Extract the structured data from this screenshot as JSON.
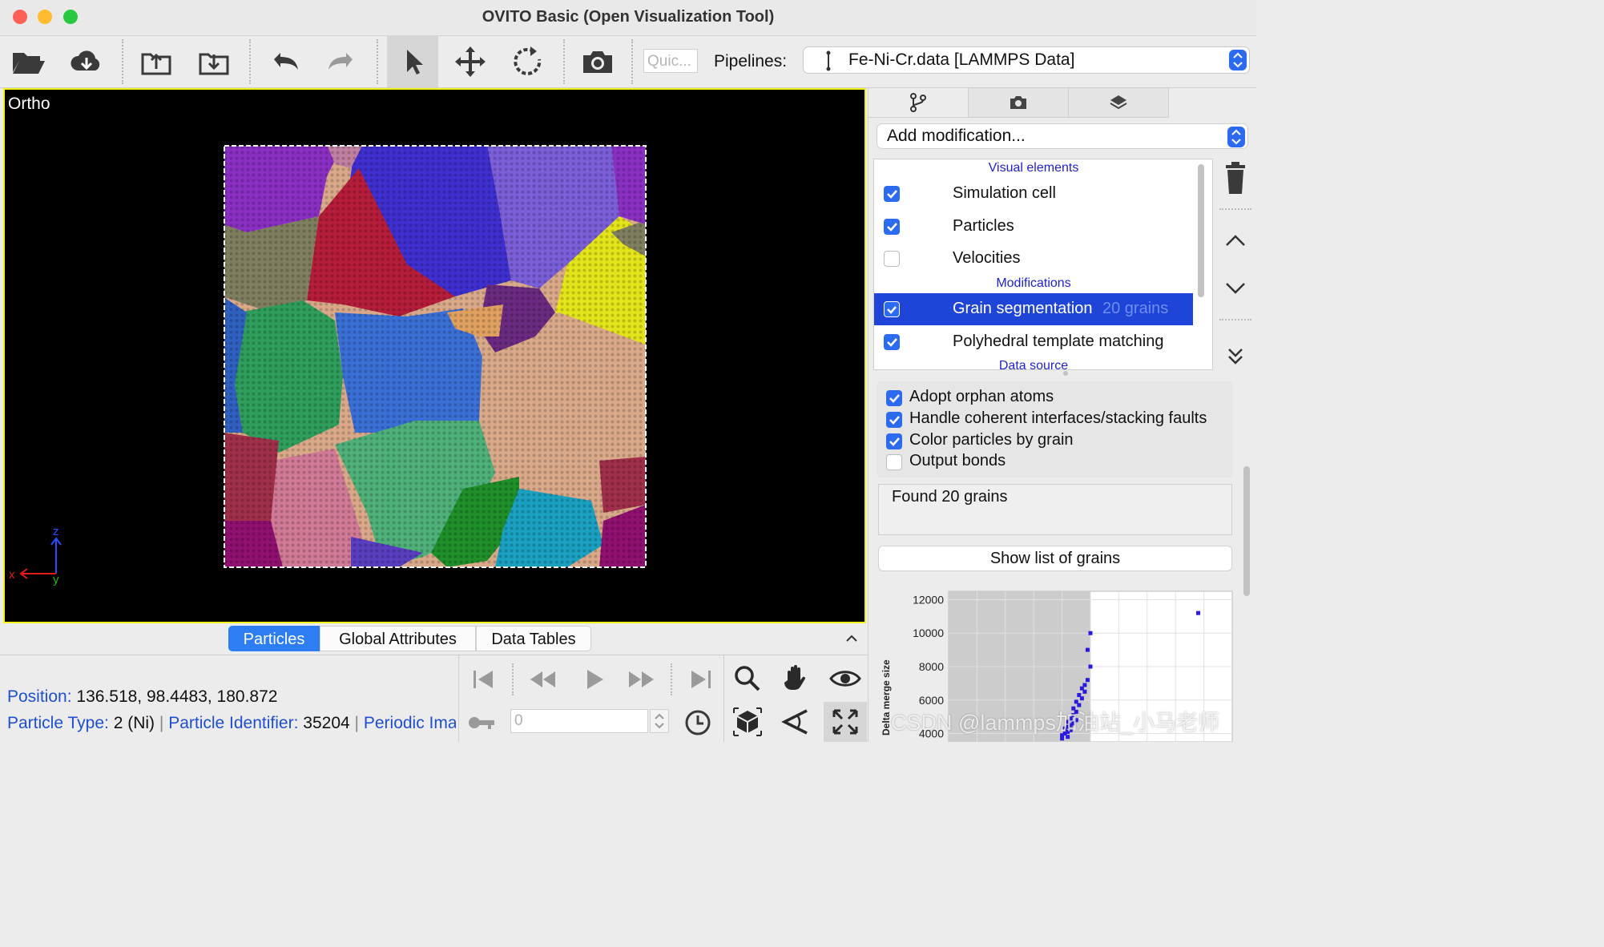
{
  "window": {
    "title": "OVITO Basic (Open Visualization Tool)"
  },
  "toolbar": {
    "quick_placeholder": "Quic...",
    "pipelines_label": "Pipelines:",
    "pipeline_selected": "Fe-Ni-Cr.data [LAMMPS Data]"
  },
  "viewport": {
    "label": "Ortho",
    "axis_z": "z",
    "axis_x": "x",
    "axis_y": "y",
    "grain_colors": [
      "#8a2fc4",
      "#3f2fd0",
      "#7a5fd8",
      "#b61d3a",
      "#7f7f60",
      "#e4e41a",
      "#2f9e5c",
      "#3a6fd6",
      "#d9a98a",
      "#d07a96",
      "#4fb07a",
      "#1f8f2a",
      "#1aa0c0",
      "#6a2a80",
      "#e0a060",
      "#a0304a",
      "#5a3ec0",
      "#c080a0",
      "#3060c0",
      "#901070"
    ]
  },
  "data_inspector": {
    "tabs": [
      "Particles",
      "Global Attributes",
      "Data Tables"
    ],
    "active_tab": "Particles",
    "position_label": "Position:",
    "position_value": "136.518, 98.4483, 180.872",
    "ptype_label": "Particle Type:",
    "ptype_value": "2 (Ni)",
    "sep": "|",
    "pid_label": "Particle Identifier:",
    "pid_value": "35204",
    "periodic_label": "Periodic Ima",
    "frame_value": "0"
  },
  "right_panel": {
    "add_modification": "Add modification...",
    "visual_elements_header": "Visual elements",
    "modifications_header": "Modifications",
    "data_source_header": "Data source",
    "visual_elements": [
      {
        "label": "Simulation cell",
        "checked": true
      },
      {
        "label": "Particles",
        "checked": true
      },
      {
        "label": "Velocities",
        "checked": false
      }
    ],
    "modifications": [
      {
        "label": "Grain segmentation",
        "status": "20 grains",
        "checked": true,
        "selected": true
      },
      {
        "label": "Polyhedral template matching",
        "checked": true,
        "selected": false
      }
    ],
    "options": [
      {
        "label": "Adopt orphan atoms",
        "checked": true
      },
      {
        "label": "Handle coherent interfaces/stacking faults",
        "checked": true
      },
      {
        "label": "Color particles by grain",
        "checked": true
      },
      {
        "label": "Output bonds",
        "checked": false
      }
    ],
    "found_text": "Found 20 grains",
    "show_list_button": "Show list of grains"
  },
  "watermark": "CSDN @lammps加油站_小马老师",
  "colors": {
    "accent": "#2c6bf0",
    "selection": "#1f45d8",
    "viewport_border": "#f2f21a",
    "link_blue": "#1f4fd0"
  },
  "chart_data": {
    "type": "scatter",
    "ylabel": "Delta merge size",
    "y_ticks": [
      4000,
      6000,
      8000,
      10000,
      12000
    ],
    "ylim": [
      3500,
      12500
    ],
    "xlim": [
      0,
      1
    ],
    "shaded_region": [
      0,
      0.5
    ],
    "points": [
      [
        0.5,
        10000
      ],
      [
        0.49,
        9000
      ],
      [
        0.5,
        8000
      ],
      [
        0.49,
        7200
      ],
      [
        0.48,
        6900
      ],
      [
        0.47,
        6700
      ],
      [
        0.48,
        6500
      ],
      [
        0.46,
        6300
      ],
      [
        0.47,
        6100
      ],
      [
        0.45,
        5900
      ],
      [
        0.46,
        5700
      ],
      [
        0.44,
        5500
      ],
      [
        0.45,
        5300
      ],
      [
        0.44,
        5100
      ],
      [
        0.43,
        4900
      ],
      [
        0.45,
        4800
      ],
      [
        0.42,
        4700
      ],
      [
        0.44,
        4600
      ],
      [
        0.43,
        4500
      ],
      [
        0.42,
        4400
      ],
      [
        0.41,
        4300
      ],
      [
        0.43,
        4200
      ],
      [
        0.42,
        4100
      ],
      [
        0.41,
        4000
      ],
      [
        0.4,
        3900
      ],
      [
        0.42,
        3800
      ],
      [
        0.4,
        3700
      ],
      [
        0.88,
        11200
      ]
    ]
  }
}
